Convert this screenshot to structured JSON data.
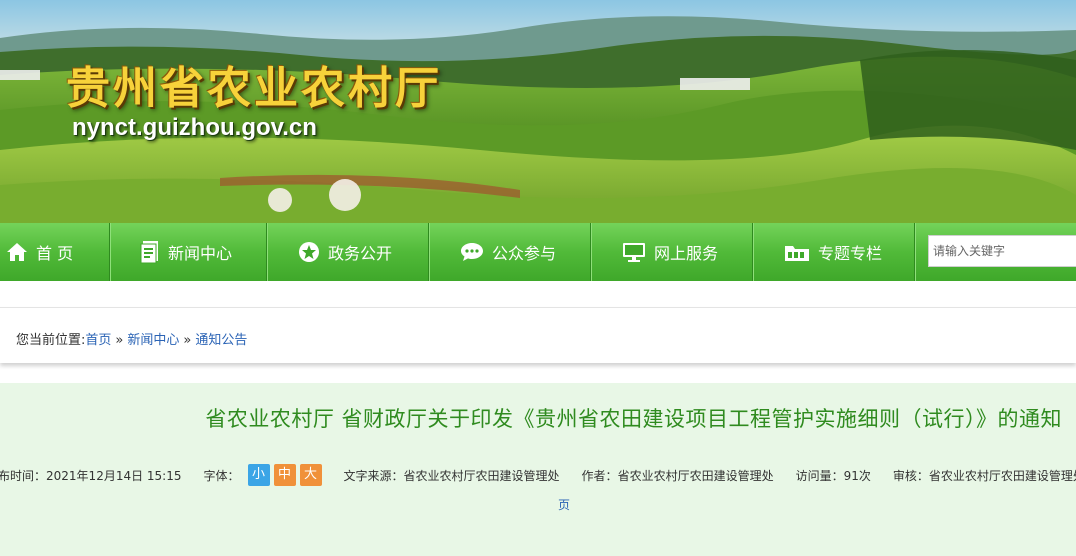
{
  "header": {
    "site_title": "贵州省农业农村厅",
    "site_domain": "nynct.guizhou.gov.cn"
  },
  "nav": {
    "items": [
      {
        "label": "首 页",
        "icon": "home-icon"
      },
      {
        "label": "新闻中心",
        "icon": "document-icon"
      },
      {
        "label": "政务公开",
        "icon": "star-icon"
      },
      {
        "label": "公众参与",
        "icon": "chat-bubble-icon"
      },
      {
        "label": "网上服务",
        "icon": "monitor-icon"
      },
      {
        "label": "专题专栏",
        "icon": "folder-icon"
      }
    ],
    "search_placeholder": "请输入关键字"
  },
  "breadcrumb": {
    "prefix": "您当前位置:",
    "items": [
      "首页",
      "新闻中心",
      "通知公告"
    ],
    "separator": "»"
  },
  "article": {
    "title": "省农业农村厅 省财政厅关于印发《贵州省农田建设项目工程管护实施细则（试行）》的通知",
    "publish_label": "发布时间：",
    "publish_time": "2021年12月14日 15:15",
    "font_label": "字体：",
    "font_sizes": [
      "小",
      "中",
      "大"
    ],
    "source_label": "文字来源：",
    "source": "省农业农村厅农田建设管理处",
    "author_label": "作者：",
    "author": "省农业农村厅农田建设管理处",
    "views_label": "访问量：",
    "views": "91次",
    "reviewer_label": "审核：",
    "reviewer": "省农业农村厅农田建设管理处",
    "page_link": "页"
  },
  "colors": {
    "nav_green": "#51ba39",
    "title_green": "#2f8b1f",
    "article_bg": "#e8f7e6",
    "title_gold": "#f7d23a",
    "link_blue": "#2a63b5",
    "font_small_blue": "#3ba5e6",
    "font_orange": "#f0913a"
  }
}
